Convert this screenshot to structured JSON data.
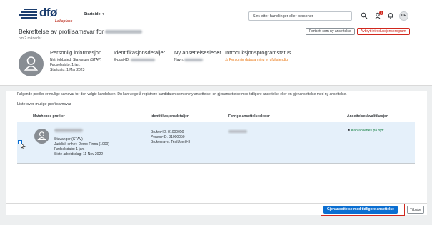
{
  "header": {
    "logo_text": "dfø",
    "logo_sub": "Lokeplass",
    "nav_label": "Startside",
    "search_placeholder": "Søk etter handlinger eller personer",
    "notification_count": "6",
    "user_initials": "LE"
  },
  "object": {
    "title_prefix": "Bekreftelse av profilsamsvar for",
    "subtitle": "om 2 måneder",
    "continue_button": "Fortsett som ny ansettelse",
    "cancel_button": "Avbryt introduksjonsprogram",
    "sections": {
      "personal": {
        "title": "Personlig informasjon",
        "lines": [
          "Nytt jobbsted: Stavanger (STAV)",
          "Fødselsdato: 1 jan.",
          "Startdato: 1 Mar 2023"
        ]
      },
      "ident": {
        "title": "Identifikasjonsdetaljer",
        "email_label": "E-post-ID:"
      },
      "manager": {
        "title": "Ny ansettelsesleder",
        "name_label": "Navn:"
      },
      "status": {
        "title": "Introduksjonsprogramstatus",
        "warning": "Personlig datasanning er ufullstendig"
      }
    }
  },
  "content": {
    "info": "Følgende profiler er mulige samsvar for den valgte kandidaten. Du kan velge å registrere kandidaten som en ny ansettelse, en gjenansettelse med tidligere ansettelse eller en gjenansettelse med ny ansettelse.",
    "list_title": "Liste over mulige profilsamsvar",
    "columns": [
      "Matchende profiler",
      "Identifikasjonsdetaljer",
      "Forrige ansettelsesleder",
      "Ansettelseskvalifikasjon"
    ],
    "row": {
      "profile_lines": [
        "Stavanger (STAV)",
        "Juridisk enhet: Demo Firma (1000)",
        "Fødselsdato: 1 jan.",
        "Siste arbeidsdag: 11 Nov 2022"
      ],
      "ident_lines": [
        "Bruker-ID: 81000050",
        "Person-ID: 81000050",
        "Brukernavn: TestUser8-3"
      ],
      "qualification": "Kan ansettes på nytt"
    }
  },
  "footer": {
    "primary_button": "Gjenansettelse med tidligere ansettelse",
    "back_button": "Tilbake"
  }
}
